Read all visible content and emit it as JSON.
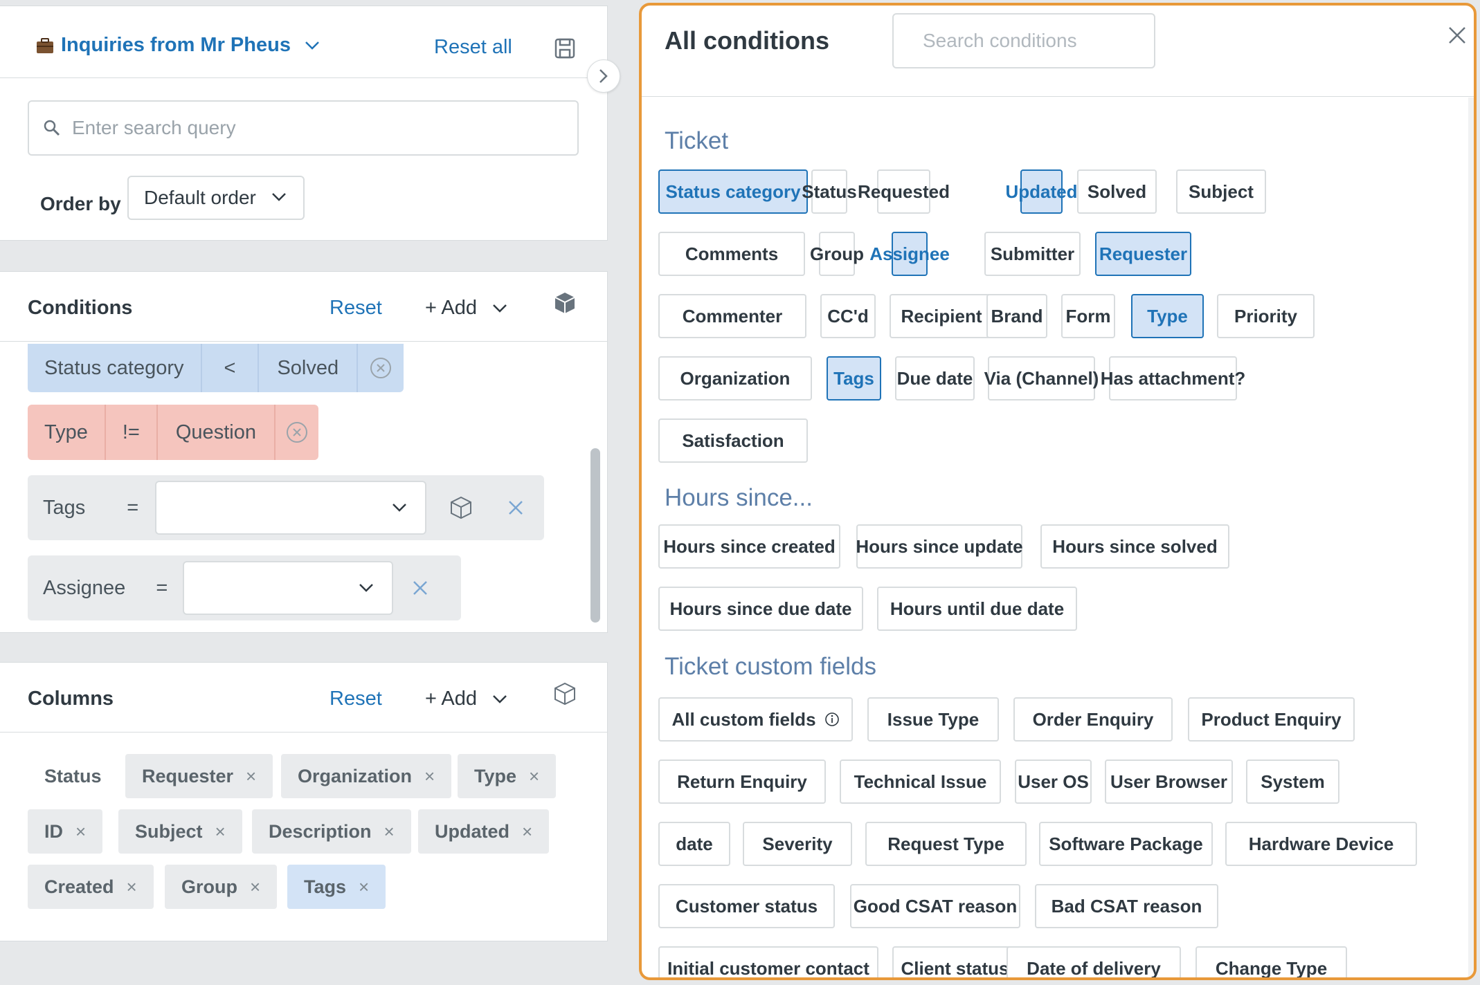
{
  "view": {
    "title": "Inquiries from Mr Pheus",
    "reset_all": "Reset all",
    "search_placeholder": "Enter search query",
    "order_by_label": "Order by",
    "order_by_value": "Default order"
  },
  "conditions": {
    "title": "Conditions",
    "reset": "Reset",
    "add": "+ Add",
    "rows": [
      {
        "field": "Status category",
        "operator": "<",
        "value": "Solved"
      },
      {
        "field": "Type",
        "operator": "!=",
        "value": "Question"
      },
      {
        "field": "Tags",
        "operator": "=",
        "value": ""
      },
      {
        "field": "Assignee",
        "operator": "=",
        "value": ""
      }
    ]
  },
  "columns": {
    "title": "Columns",
    "reset": "Reset",
    "add": "+ Add",
    "items": [
      "Status",
      "Requester",
      "Organization",
      "Type",
      "ID",
      "Subject",
      "Description",
      "Updated",
      "Created",
      "Group",
      "Tags"
    ],
    "remove_glyph": "×"
  },
  "panel": {
    "title": "All conditions",
    "search_placeholder": "Search conditions",
    "groups": [
      {
        "title": "Ticket",
        "items": [
          {
            "label": "Status category",
            "selected": true
          },
          {
            "label": "Status",
            "selected": false
          },
          {
            "label": "Requested",
            "selected": false
          },
          {
            "label": "Updated",
            "selected": true
          },
          {
            "label": "Solved",
            "selected": false
          },
          {
            "label": "Subject",
            "selected": false
          },
          {
            "label": "Comments",
            "selected": false
          },
          {
            "label": "Group",
            "selected": false
          },
          {
            "label": "Assignee",
            "selected": true
          },
          {
            "label": "Submitter",
            "selected": false
          },
          {
            "label": "Requester",
            "selected": true
          },
          {
            "label": "Commenter",
            "selected": false
          },
          {
            "label": "CC'd",
            "selected": false
          },
          {
            "label": "Recipient",
            "selected": false
          },
          {
            "label": "Brand",
            "selected": false
          },
          {
            "label": "Form",
            "selected": false
          },
          {
            "label": "Type",
            "selected": true
          },
          {
            "label": "Priority",
            "selected": false
          },
          {
            "label": "Organization",
            "selected": false
          },
          {
            "label": "Tags",
            "selected": true
          },
          {
            "label": "Due date",
            "selected": false
          },
          {
            "label": "Via (Channel)",
            "selected": false
          },
          {
            "label": "Has attachment?",
            "selected": false
          },
          {
            "label": "Satisfaction",
            "selected": false
          }
        ]
      },
      {
        "title": "Hours since...",
        "items": [
          {
            "label": "Hours since created",
            "selected": false
          },
          {
            "label": "Hours since update",
            "selected": false
          },
          {
            "label": "Hours since solved",
            "selected": false
          },
          {
            "label": "Hours since due date",
            "selected": false
          },
          {
            "label": "Hours until due date",
            "selected": false
          }
        ]
      },
      {
        "title": "Ticket custom fields",
        "items": [
          {
            "label": "All custom fields",
            "selected": false,
            "info": true
          },
          {
            "label": "Issue Type",
            "selected": false
          },
          {
            "label": "Order Enquiry",
            "selected": false
          },
          {
            "label": "Product Enquiry",
            "selected": false
          },
          {
            "label": "Return Enquiry",
            "selected": false
          },
          {
            "label": "Technical Issue",
            "selected": false
          },
          {
            "label": "User OS",
            "selected": false
          },
          {
            "label": "User Browser",
            "selected": false
          },
          {
            "label": "System",
            "selected": false
          },
          {
            "label": "date",
            "selected": false
          },
          {
            "label": "Severity",
            "selected": false
          },
          {
            "label": "Request Type",
            "selected": false
          },
          {
            "label": "Software Package",
            "selected": false
          },
          {
            "label": "Hardware Device",
            "selected": false
          },
          {
            "label": "Customer status",
            "selected": false
          },
          {
            "label": "Good CSAT reason",
            "selected": false
          },
          {
            "label": "Bad CSAT reason",
            "selected": false
          },
          {
            "label": "Initial customer contact",
            "selected": false
          },
          {
            "label": "Client status",
            "selected": false
          },
          {
            "label": "Date of delivery",
            "selected": false
          },
          {
            "label": "Change Type",
            "selected": false
          }
        ]
      }
    ]
  },
  "colors": {
    "link": "#1f73b7",
    "selected_bg": "#d3e3f6",
    "cond_blue": "#c9dcf2",
    "cond_red": "#f5c5be",
    "panel_border": "#e8993a",
    "group_title": "#5d7fa8"
  },
  "icons": [
    "briefcase-icon",
    "chevron-down-icon",
    "save-icon",
    "search-icon",
    "cube-icon",
    "close-icon",
    "circle-x-icon",
    "chevron-right-icon",
    "info-icon"
  ]
}
